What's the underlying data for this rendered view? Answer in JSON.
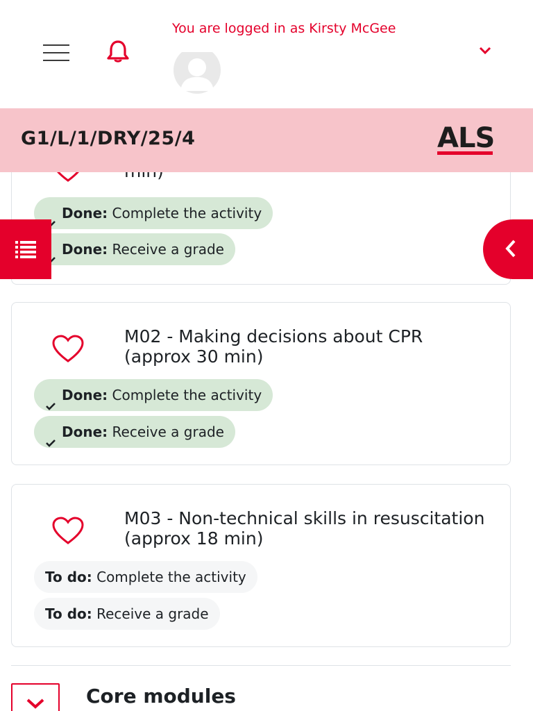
{
  "header": {
    "login_text": "You are logged in as Kirsty McGee",
    "menu_icon": "hamburger-icon",
    "notification_icon": "bell-icon",
    "user_menu_icon": "chevron-down-icon"
  },
  "course": {
    "code": "G1/L/1/DRY/25/4",
    "logo_text": "ALS"
  },
  "activities": [
    {
      "title_fragment": "min)",
      "conditions": [
        {
          "status": "Done:",
          "text": "Complete the activity",
          "state": "done"
        },
        {
          "status": "Done:",
          "text": "Receive a grade",
          "state": "done"
        }
      ]
    },
    {
      "title": "M02 - Making decisions about CPR (approx 30 min)",
      "conditions": [
        {
          "status": "Done:",
          "text": "Complete the activity",
          "state": "done"
        },
        {
          "status": "Done:",
          "text": "Receive a grade",
          "state": "done"
        }
      ]
    },
    {
      "title": "M03 - Non-technical skills in resuscitation (approx 18 min)",
      "conditions": [
        {
          "status": "To do:",
          "text": "Complete the activity",
          "state": "todo"
        },
        {
          "status": "To do:",
          "text": "Receive a grade",
          "state": "todo"
        }
      ]
    }
  ],
  "section": {
    "title": "Core modules"
  },
  "colors": {
    "accent": "#e4002b",
    "band": "#f7c4ca",
    "done_pill": "#d6e8d6",
    "todo_pill": "#f5f6f7"
  }
}
